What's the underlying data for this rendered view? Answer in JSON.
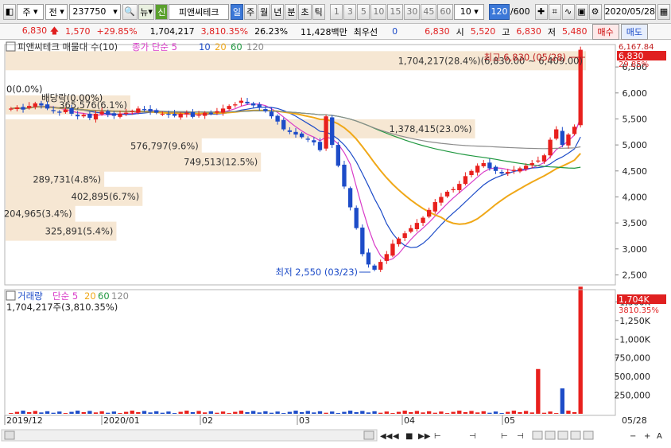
{
  "toolbar": {
    "market_type": "주",
    "compare_label": "전",
    "code": "237750",
    "new_label": "뉴",
    "shin_label": "신",
    "stock_name": "피앤씨테크",
    "period_tabs": [
      "일",
      "주",
      "월",
      "년",
      "분",
      "초",
      "틱"
    ],
    "selected_period": "일",
    "minutes": [
      "1",
      "3",
      "5",
      "10",
      "15",
      "30",
      "45",
      "60"
    ],
    "minute_value": "10",
    "count_value": "120",
    "count_total": "/600",
    "date": "2020/05/28"
  },
  "info": {
    "price": "6,830",
    "change": "1,570",
    "change_pct": "+29.85%",
    "volume": "1,704,217",
    "volume_pct": "3,810.35%",
    "turnover": "26.23%",
    "amount": "11,428백만",
    "best_label": "최우선",
    "best_value": "0",
    "ask": "6,830",
    "open_label": "시",
    "open": "5,520",
    "high_label": "고",
    "high": "6,830",
    "low_label": "저",
    "low": "5,480",
    "buy_label": "매수",
    "sell_label": "매도"
  },
  "price_chart": {
    "legend_name": "피앤씨테크 매물대 수(10)",
    "ma_label": "종가 단순 5",
    "ma_periods": [
      "10",
      "20",
      "60",
      "120"
    ],
    "high_annotation": "최고 6,830 (05/28)",
    "low_annotation": "최저 2,550 (03/23)",
    "dividend_label": "배당락(0.00%)",
    "zero_label": "0(0.0%)",
    "current_price_tag": "6,830",
    "current_pct_tag": "29.85%",
    "top_axis_label": "6,167.84",
    "y_ticks": [
      "6,500",
      "6,000",
      "5,500",
      "5,000",
      "4,500",
      "4,000",
      "3,500",
      "3,000",
      "2,500"
    ],
    "volume_profile": [
      {
        "label": "1,704,217(28.4%)(6,830.00 ~ 6,409.00)",
        "fraction": 1.0
      },
      {
        "label": "365,576(6.1%)",
        "fraction": 0.215
      },
      {
        "label": "1,378,415(23.0%)",
        "fraction": 0.809
      },
      {
        "label": "576,797(9.6%)",
        "fraction": 0.338
      },
      {
        "label": "749,513(12.5%)",
        "fraction": 0.44
      },
      {
        "label": "289,731(4.8%)",
        "fraction": 0.17
      },
      {
        "label": "402,895(6.7%)",
        "fraction": 0.236
      },
      {
        "label": "204,965(3.4%)",
        "fraction": 0.12
      },
      {
        "label": "325,891(5.4%)",
        "fraction": 0.191
      }
    ]
  },
  "volume_chart": {
    "legend_name": "거래량",
    "ma_label": "단순 5",
    "ma_periods": [
      "20",
      "60",
      "120"
    ],
    "value_label": "1,704,217주(3,810.35%)",
    "current_tag": "1,704K",
    "current_pct_tag": "3810.35%",
    "y_ticks": [
      "1,500K",
      "1,250K",
      "1,000K",
      "750,000",
      "500,000",
      "250,000"
    ]
  },
  "x_axis": {
    "labels": [
      "2019/12",
      "2020/01",
      "02",
      "03",
      "04",
      "05"
    ],
    "right_label": "05/28"
  },
  "colors": {
    "up": "#e8201d",
    "down": "#1d4cc8",
    "ma5": "#d93cc8",
    "ma10": "#1d4cc8",
    "ma20": "#f0a818",
    "ma60": "#209840",
    "ma120": "#8c8c8c",
    "profile": "#f6e7d3"
  },
  "chart_data": {
    "type": "candlestick",
    "y_range": [
      2400,
      6900
    ],
    "ohlc_summary": {
      "high": 6830,
      "high_date": "05/28",
      "low": 2550,
      "low_date": "03/23",
      "last_close": 6830
    },
    "close_series": [
      5700,
      5720,
      5680,
      5750,
      5800,
      5760,
      5700,
      5650,
      5620,
      5680,
      5600,
      5550,
      5580,
      5520,
      5600,
      5640,
      5580,
      5560,
      5600,
      5620,
      5650,
      5700,
      5680,
      5640,
      5620,
      5600,
      5580,
      5560,
      5600,
      5620,
      5540,
      5580,
      5620,
      5600,
      5650,
      5700,
      5750,
      5780,
      5850,
      5800,
      5760,
      5720,
      5650,
      5550,
      5450,
      5300,
      5250,
      5200,
      5150,
      5100,
      5050,
      4900,
      5550,
      5000,
      4600,
      4200,
      3800,
      3400,
      2900,
      2700,
      2600,
      2750,
      2900,
      3100,
      3200,
      3300,
      3400,
      3500,
      3600,
      3750,
      3900,
      4000,
      4100,
      4150,
      4250,
      4400,
      4500,
      4600,
      4650,
      4550,
      4500,
      4450,
      4480,
      4520,
      4550,
      4600,
      4650,
      4700,
      4800,
      5100,
      5300,
      5000,
      5200,
      5350,
      6830
    ]
  }
}
